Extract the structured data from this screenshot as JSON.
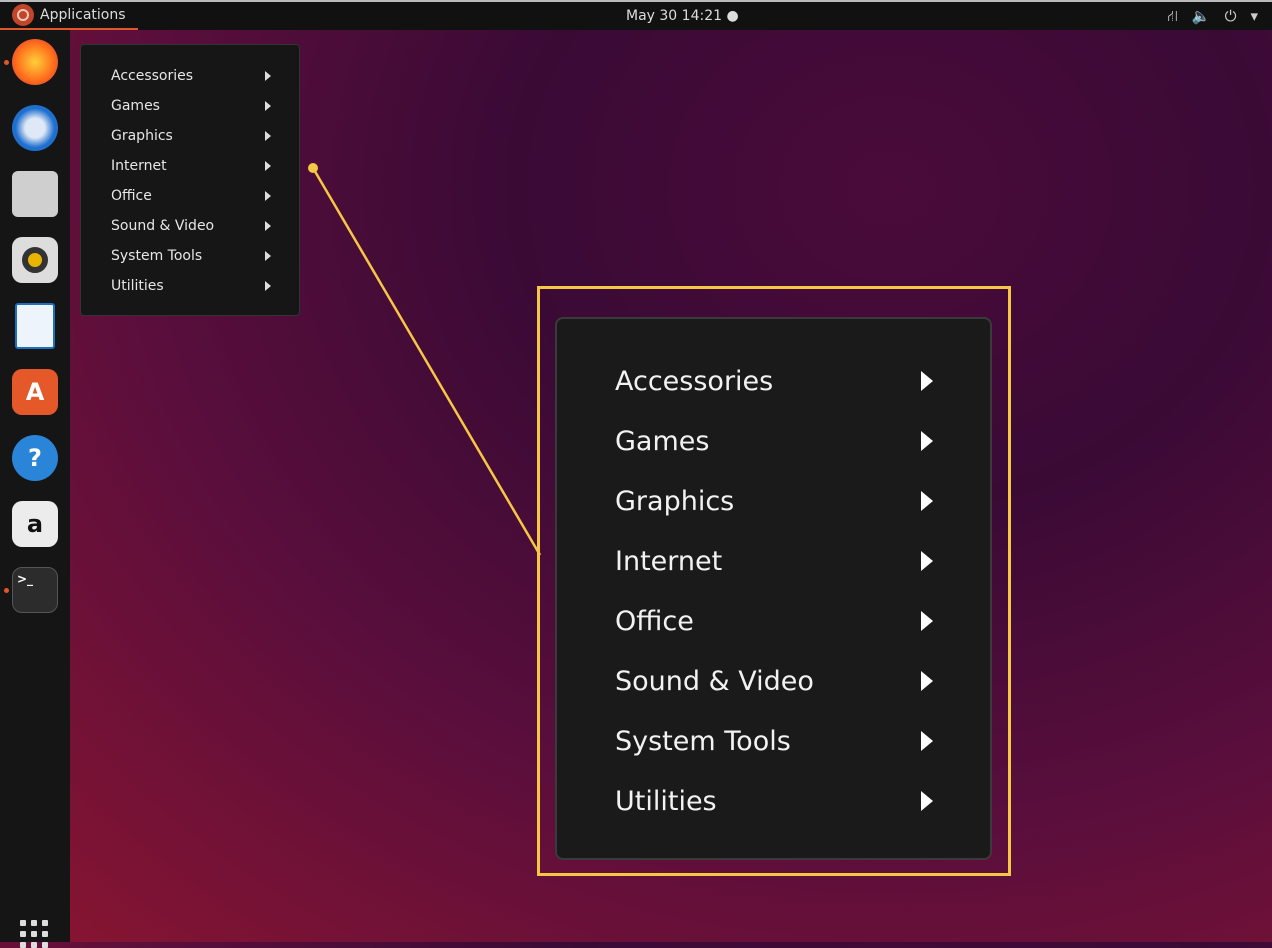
{
  "topbar": {
    "applications_label": "Applications",
    "clock": "May 30  14:21 ●",
    "tray_icons": [
      "network-icon",
      "volume-icon",
      "power-icon",
      "dropdown-icon"
    ]
  },
  "dock": {
    "apps": [
      "Firefox",
      "Thunderbird",
      "Files",
      "Rhythmbox",
      "LibreOffice Writer",
      "Ubuntu Software",
      "Help",
      "Amazon",
      "Terminal"
    ],
    "show_apps": "grid-icon"
  },
  "menu": {
    "items": [
      "Accessories",
      "Games",
      "Graphics",
      "Internet",
      "Office",
      "Sound & Video",
      "System Tools",
      "Utilities"
    ]
  },
  "callout": {
    "border_color": "#f6c744"
  }
}
